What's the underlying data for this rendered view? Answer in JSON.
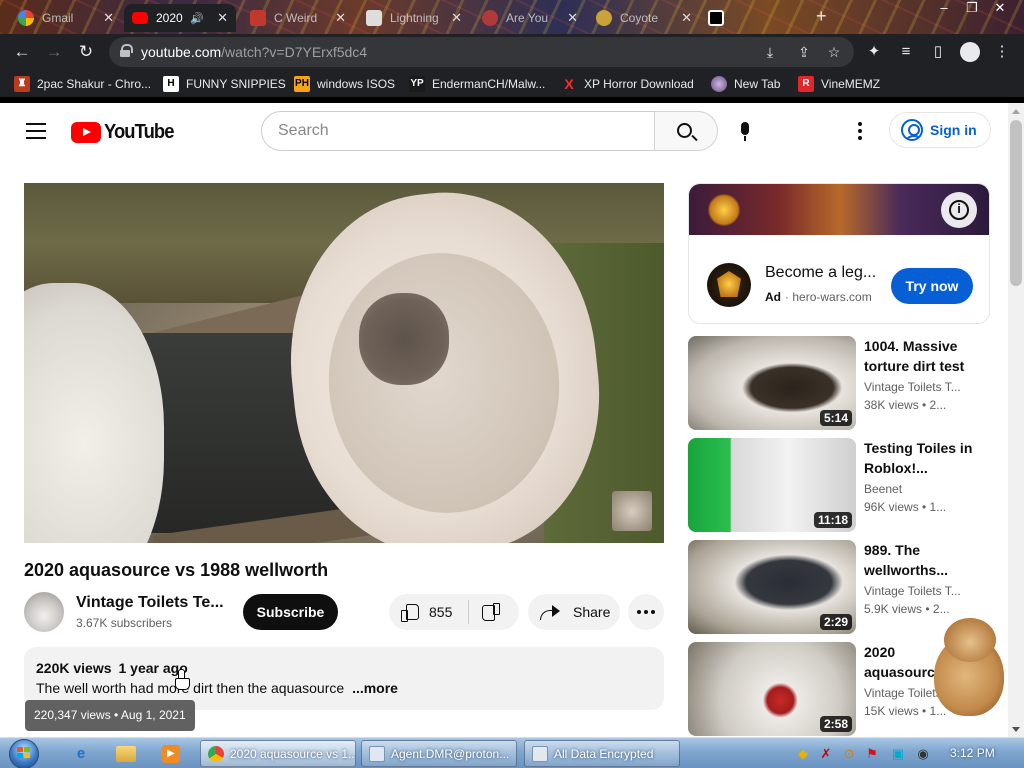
{
  "browser": {
    "tabs": [
      {
        "label": "Gmail",
        "active": false
      },
      {
        "label": "2020 aquasource vs 1988 wellworth",
        "active": true
      },
      {
        "label": "C Weird",
        "active": false
      },
      {
        "label": "Lightning",
        "active": false
      },
      {
        "label": "Are You",
        "active": false
      },
      {
        "label": "Coyote",
        "active": false
      }
    ],
    "url": {
      "host": "youtube.com",
      "path": "/watch?v=D7YErxf5dc4"
    },
    "bookmarks": [
      {
        "label": "2pac Shakur - Chro...",
        "icon": "red-bull-icon"
      },
      {
        "label": "FUNNY SNIPPIES",
        "icon": "h-icon"
      },
      {
        "label": "windows ISOS",
        "icon": "ph-icon"
      },
      {
        "label": "EndermanCH/Malw...",
        "icon": "yp-icon"
      },
      {
        "label": "XP Horror Download",
        "icon": "x-icon"
      },
      {
        "label": "New Tab",
        "icon": "globe-icon"
      },
      {
        "label": "VineMEMZ",
        "icon": "r-icon"
      }
    ]
  },
  "youtube": {
    "logo_text": "YouTube",
    "search_placeholder": "Search",
    "signin_label": "Sign in",
    "video": {
      "title": "2020 aquasource vs 1988 wellworth",
      "channel": "Vintage Toilets Te...",
      "subscribers": "3.67K subscribers",
      "subscribe_label": "Subscribe",
      "likes": "855",
      "share_label": "Share",
      "views": "220K views",
      "age": "1 year ago",
      "description": "The well worth had more dirt then the aquasource",
      "more_label": "...more",
      "tooltip": "220,347 views • Aug 1, 2021"
    },
    "ad": {
      "title": "Become a leg...",
      "badge": "Ad",
      "domain": "hero-wars.com",
      "cta": "Try now"
    },
    "suggestions": [
      {
        "title": "1004. Massive torture dirt test",
        "channel": "Vintage Toilets T...",
        "meta": "38K views • 2...",
        "duration": "5:14"
      },
      {
        "title": "Testing Toiles in Roblox!...",
        "channel": "Beenet",
        "meta": "96K views • 1...",
        "duration": "11:18"
      },
      {
        "title": "989. The wellworths...",
        "channel": "Vintage Toilets T...",
        "meta": "5.9K views • 2...",
        "duration": "2:29"
      },
      {
        "title": "2020 aquasource...",
        "channel": "Vintage Toilets T...",
        "meta": "15K views • 1...",
        "duration": "2:58"
      }
    ]
  },
  "taskbar": {
    "tasks": [
      {
        "label": "2020 aquasource vs 1...",
        "active": true
      },
      {
        "label": "Agent.DMR@proton...",
        "active": false
      },
      {
        "label": "All Data Encrypted",
        "active": false
      }
    ],
    "clock": "3:12 PM"
  },
  "colors": {
    "youtube_red": "#ff0000",
    "link_blue": "#065fd4",
    "chrome_dark": "#202124"
  }
}
